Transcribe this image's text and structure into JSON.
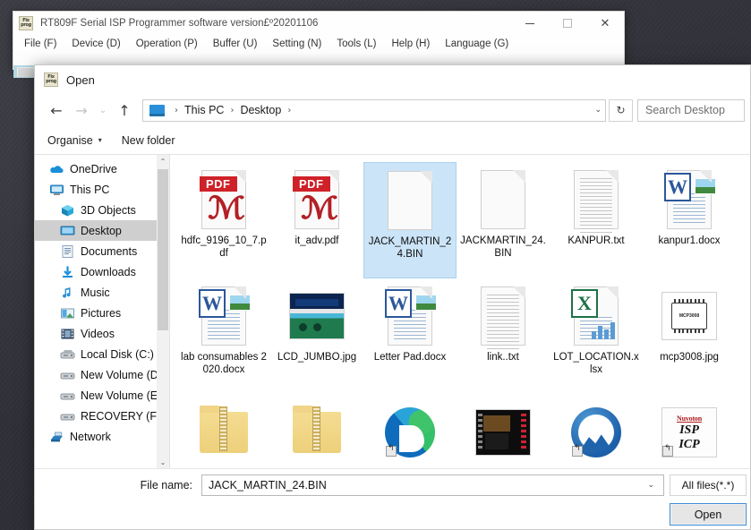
{
  "main_window": {
    "title": "RT809F Serial ISP Programmer software version£º20201106",
    "app_icon": "fixprog-icon",
    "window_controls": {
      "minimize": "–",
      "maximize": "□",
      "close": "✕"
    },
    "menu": [
      {
        "label": "File (F)"
      },
      {
        "label": "Device (D)"
      },
      {
        "label": "Operation (P)"
      },
      {
        "label": "Buffer (U)"
      },
      {
        "label": "Setting (N)"
      },
      {
        "label": "Tools (L)"
      },
      {
        "label": "Help (H)"
      },
      {
        "label": "Language (G)"
      }
    ]
  },
  "dialog": {
    "title": "Open",
    "icon": "fixprog-icon",
    "nav": {
      "back": "←",
      "forward": "→",
      "recent": "⌄",
      "up": "↑",
      "refresh": "↻",
      "dropdown_caret": "⌄"
    },
    "breadcrumb": {
      "root_icon": "this-pc-icon",
      "separator": "›",
      "parts": [
        "This PC",
        "Desktop"
      ]
    },
    "search": {
      "placeholder": "Search Desktop"
    },
    "commands": {
      "organise": "Organise",
      "organise_caret": "▾",
      "new_folder": "New folder"
    },
    "tree": {
      "items": [
        {
          "label": "OneDrive",
          "icon": "onedrive-icon",
          "indent": false,
          "selected": false
        },
        {
          "label": "This PC",
          "icon": "this-pc-icon",
          "indent": false,
          "selected": false
        },
        {
          "label": "3D Objects",
          "icon": "3d-objects-icon",
          "indent": true,
          "selected": false
        },
        {
          "label": "Desktop",
          "icon": "desktop-icon",
          "indent": true,
          "selected": true
        },
        {
          "label": "Documents",
          "icon": "documents-icon",
          "indent": true,
          "selected": false
        },
        {
          "label": "Downloads",
          "icon": "downloads-icon",
          "indent": true,
          "selected": false
        },
        {
          "label": "Music",
          "icon": "music-icon",
          "indent": true,
          "selected": false
        },
        {
          "label": "Pictures",
          "icon": "pictures-icon",
          "indent": true,
          "selected": false
        },
        {
          "label": "Videos",
          "icon": "videos-icon",
          "indent": true,
          "selected": false
        },
        {
          "label": "Local Disk (C:)",
          "icon": "local-disk-icon",
          "indent": true,
          "selected": false
        },
        {
          "label": "New Volume (D:",
          "icon": "drive-icon",
          "indent": true,
          "selected": false
        },
        {
          "label": "New Volume (E:)",
          "icon": "drive-icon",
          "indent": true,
          "selected": false
        },
        {
          "label": "RECOVERY (F:)",
          "icon": "drive-icon",
          "indent": true,
          "selected": false
        },
        {
          "label": "Network",
          "icon": "network-icon",
          "indent": false,
          "selected": false
        }
      ],
      "scroll_up": "⌃",
      "scroll_down": "⌄"
    },
    "files": [
      {
        "name": "hdfc_9196_10_7.pdf",
        "kind": "pdf",
        "selected": false
      },
      {
        "name": "it_adv.pdf",
        "kind": "pdf",
        "selected": false
      },
      {
        "name": "JACK_MARTIN_24.BIN",
        "kind": "bin",
        "selected": true
      },
      {
        "name": "JACKMARTIN_24.BIN",
        "kind": "bin",
        "selected": false
      },
      {
        "name": "KANPUR.txt",
        "kind": "txt",
        "selected": false
      },
      {
        "name": "kanpur1.docx",
        "kind": "docx",
        "selected": false
      },
      {
        "name": "lab consumables 2020.docx",
        "kind": "docx",
        "selected": false
      },
      {
        "name": "LCD_JUMBO.jpg",
        "kind": "jpg-lcd",
        "selected": false
      },
      {
        "name": "Letter Pad.docx",
        "kind": "docx",
        "selected": false
      },
      {
        "name": "link..txt",
        "kind": "txt",
        "selected": false
      },
      {
        "name": "LOT_LOCATION.xlsx",
        "kind": "xlsx",
        "selected": false
      },
      {
        "name": "mcp3008.jpg",
        "kind": "jpg-chip",
        "chip_label": "MCP3008",
        "selected": false
      },
      {
        "name": "",
        "kind": "zip-folder",
        "selected": false
      },
      {
        "name": "",
        "kind": "zip-folder",
        "selected": false
      },
      {
        "name": "",
        "kind": "edge-shortcut",
        "selected": false
      },
      {
        "name": "",
        "kind": "board-photo",
        "selected": false
      },
      {
        "name": "",
        "kind": "nord-shortcut",
        "selected": false
      },
      {
        "name": "",
        "kind": "nuvoton-shortcut",
        "nuvo_brand": "Nuvoton",
        "nuvo_line1": "ISP",
        "nuvo_line2": "ICP",
        "selected": false
      }
    ],
    "footer": {
      "filename_label": "File name:",
      "filename_value": "JACK_MARTIN_24.BIN",
      "filename_caret": "⌄",
      "filetype_value": "All files(*.*)",
      "open_button": "Open"
    }
  },
  "colors": {
    "selection_blue": "#cce4f7",
    "accent_blue": "#3e8bd4",
    "pdf_red": "#cf2128",
    "word_blue": "#2b579a",
    "excel_green": "#1e7145",
    "toolbar_cyan": "#b4d8e6",
    "cursor_highlight": "#f7e96e"
  }
}
